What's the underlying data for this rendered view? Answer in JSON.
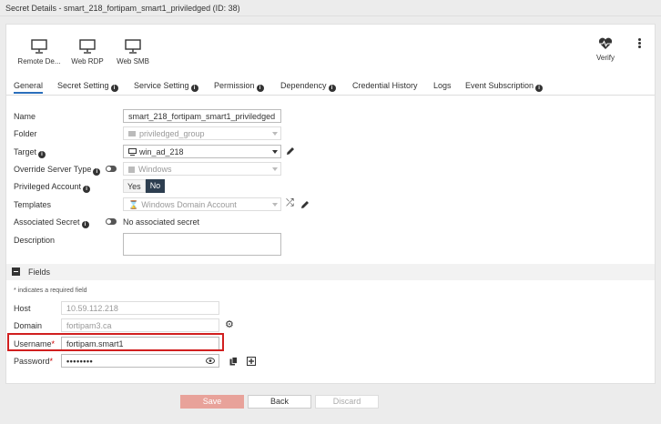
{
  "window": {
    "title": "Secret Details - smart_218_fortipam_smart1_priviledged (ID: 38)"
  },
  "toolbar": {
    "remote_desktop": "Remote De...",
    "web_rdp": "Web RDP",
    "web_smb": "Web SMB",
    "verify": "Verify"
  },
  "tabs": {
    "general": "General",
    "secret_setting": "Secret Setting",
    "service_setting": "Service Setting",
    "permission": "Permission",
    "dependency": "Dependency",
    "credential_history": "Credential History",
    "logs": "Logs",
    "event_subscription": "Event Subscription"
  },
  "form": {
    "name_label": "Name",
    "name_value": "smart_218_fortipam_smart1_priviledged",
    "folder_label": "Folder",
    "folder_value": "priviledged_group",
    "target_label": "Target",
    "target_value": "win_ad_218",
    "override_label": "Override Server Type",
    "override_value": "Windows",
    "privileged_label": "Privileged Account",
    "privileged_yes": "Yes",
    "privileged_no": "No",
    "templates_label": "Templates",
    "templates_value": "Windows Domain Account",
    "assoc_label": "Associated Secret",
    "assoc_value": "No associated secret",
    "description_label": "Description",
    "description_value": ""
  },
  "fields": {
    "section_title": "Fields",
    "required_note": "* indicates a required field",
    "host_label": "Host",
    "host_value": "10.59.112.218",
    "domain_label": "Domain",
    "domain_value": "fortipam3.ca",
    "username_label": "Username",
    "username_value": "fortipam.smart1",
    "password_label": "Password",
    "password_value": "••••••••",
    "required_mark": "*"
  },
  "footer": {
    "save": "Save",
    "back": "Back",
    "discard": "Discard"
  },
  "colors": {
    "accent": "#2a6ebb",
    "highlight": "#d11f1f",
    "save_disabled": "#e8a29a",
    "toggle_yes": "#2d3e50"
  }
}
